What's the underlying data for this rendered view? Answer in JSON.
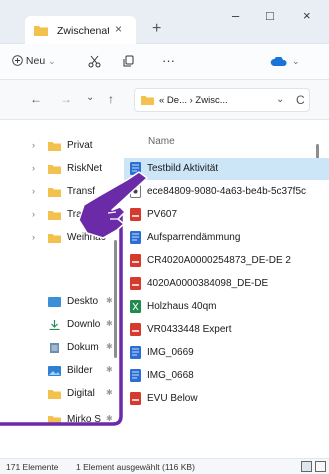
{
  "window": {
    "tab_title": "Zwischenat",
    "close_tab": "×",
    "new_tab": "+",
    "minimize": "–",
    "maximize": "□",
    "close": "×"
  },
  "commandbar": {
    "new_label": "Neu",
    "new_caret": "⌄",
    "more": "···"
  },
  "address": {
    "text": "« De... › Zwisc...",
    "dropdown": "⌄",
    "refresh": "C"
  },
  "nav_buttons": {
    "back": "←",
    "forward": "→",
    "history": "⌄",
    "up": "↑"
  },
  "navpane": {
    "items": [
      {
        "label": "Privat",
        "chevron": "›",
        "pin": ""
      },
      {
        "label": "RiskNet",
        "chevron": "›",
        "pin": ""
      },
      {
        "label": "Transf",
        "chevron": "›",
        "pin": ""
      },
      {
        "label": "Tra",
        "chevron": "›",
        "pin": ""
      },
      {
        "label": "Weihnac",
        "chevron": "›",
        "pin": ""
      },
      {
        "label": "Deskto",
        "chevron": "",
        "pin": "✱"
      },
      {
        "label": "Downlo",
        "chevron": "",
        "pin": "✱"
      },
      {
        "label": "Dokum",
        "chevron": "",
        "pin": "✱"
      },
      {
        "label": "Bilder",
        "chevron": "",
        "pin": "✱"
      },
      {
        "label": "Digital",
        "chevron": "",
        "pin": "✱"
      },
      {
        "label": "Mirko S",
        "chevron": "",
        "pin": "✱"
      }
    ]
  },
  "filelist": {
    "column_name": "Name",
    "files": [
      {
        "name": "Testbild Aktivität",
        "icon": "word",
        "selected": true
      },
      {
        "name": "ece84809-9080-4a63-be4b-5c37f5c",
        "icon": "generic",
        "selected": false
      },
      {
        "name": "PV607",
        "icon": "pdf",
        "selected": false
      },
      {
        "name": "Aufsparrendämmung",
        "icon": "word",
        "selected": false
      },
      {
        "name": "CR4020A0000254873_DE-DE 2",
        "icon": "pdf",
        "selected": false
      },
      {
        "name": "4020A0000384098_DE-DE",
        "icon": "pdf",
        "selected": false
      },
      {
        "name": "Holzhaus 40qm",
        "icon": "excel",
        "selected": false
      },
      {
        "name": "VR0433448 Expert",
        "icon": "pdf",
        "selected": false
      },
      {
        "name": "IMG_0669",
        "icon": "word",
        "selected": false
      },
      {
        "name": "IMG_0668",
        "icon": "word",
        "selected": false
      },
      {
        "name": "EVU Below",
        "icon": "pdf",
        "selected": false
      }
    ]
  },
  "statusbar": {
    "count": "171 Elemente",
    "selection": "1 Element ausgewählt (116 KB)"
  },
  "colors": {
    "folder": "#f2c14e",
    "selected_row": "#cde6f7",
    "pdf": "#d63a2f",
    "word": "#2b6fd6",
    "excel": "#1f8b4c",
    "annotation": "#6b2aa8"
  }
}
